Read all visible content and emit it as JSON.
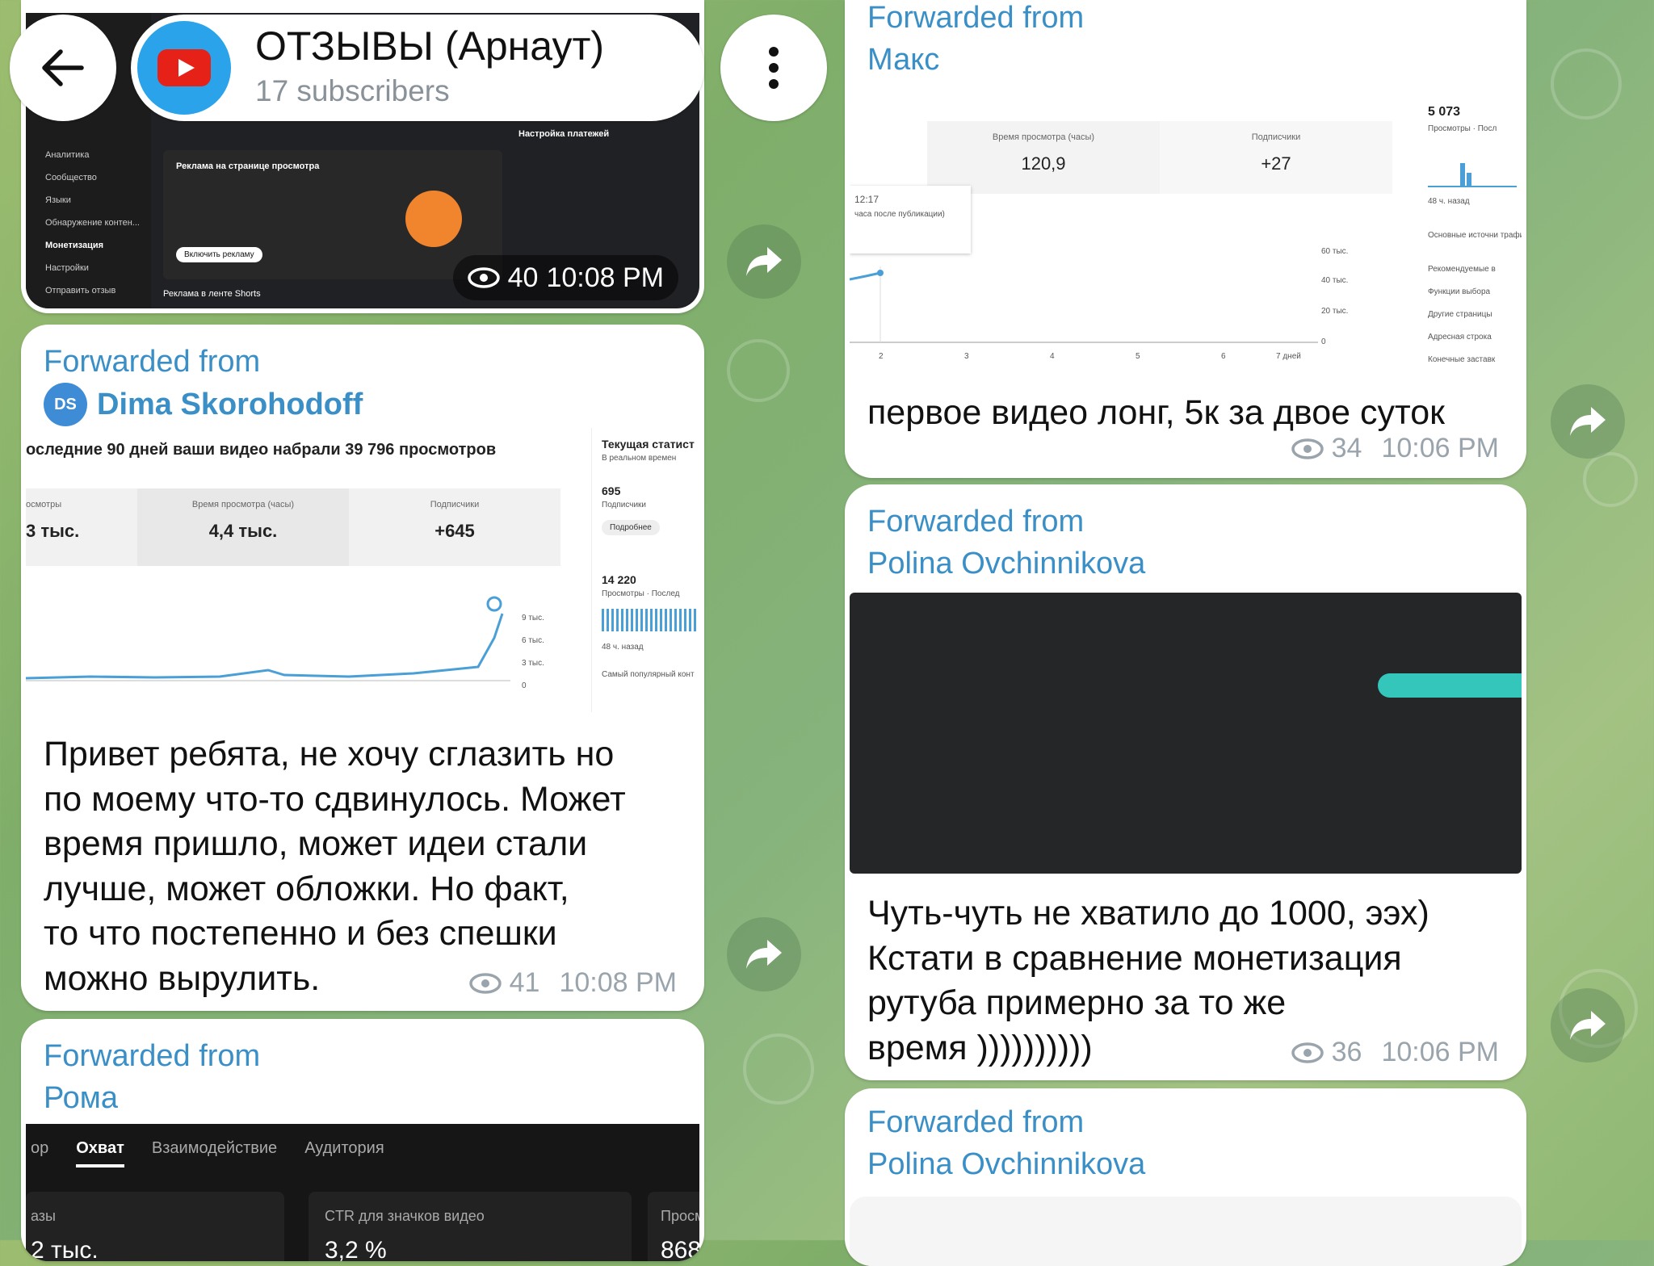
{
  "header": {
    "title": "ОТЗЫВЫ (Арнаут)",
    "subscribers": "17 subscribers"
  },
  "left": {
    "post1": {
      "views": "40",
      "time": "10:08 PM",
      "shot_menu": [
        "Аналитика",
        "Сообщество",
        "Языки",
        "Обнаружение контен...",
        "Монетизация",
        "Настройки",
        "Отправить отзыв"
      ],
      "shot_heading": "Реклама на странице просмотра",
      "shot_button": "Включить рекламу",
      "shot_side_title": "Настройка платежей",
      "shot_bottom": "Реклама в ленте Shorts"
    },
    "post2": {
      "fwd_label": "Forwarded from",
      "fwd_initials": "DS",
      "fwd_name": "Dima Skorohodoff",
      "shot_heading": "оследние 90 дней ваши видео набрали 39 796 просмотров",
      "stat1_label": "осмотры",
      "stat1_value": "3 тыс.",
      "stat2_label": "Время просмотра (часы)",
      "stat2_value": "4,4 тыс.",
      "stat3_label": "Подписчики",
      "stat3_value": "+645",
      "side_title": "Текущая статист",
      "side_sub": "В реальном времен",
      "side_v1": "695",
      "side_v1_label": "Подписчики",
      "side_button": "Подробнее",
      "side_v2": "14 220",
      "side_v2_label": "Просмотры · Послед",
      "side_ago": "48 ч. назад",
      "side_popular": "Самый популярный конт",
      "y_ticks": [
        "9 тыс.",
        "6 тыс.",
        "3 тыс.",
        "0"
      ],
      "text": "Привет ребята, не хочу сглазить но\nпо моему что-то сдвинулось. Может\nвремя пришло, может идеи стали\nлучше, может обложки. Но факт,\nто что постепенно и без спешки\nможно вырулить.",
      "views": "41",
      "time": "10:08 PM"
    },
    "post3": {
      "fwd_label": "Forwarded from",
      "fwd_name": "Рома",
      "tabs": [
        "ор",
        "Охват",
        "Взаимодействие",
        "Аудитория"
      ],
      "card1_label": "азы",
      "card1_value": "2 тыс.",
      "card2_label": "CTR для значков видео",
      "card2_value": "3,2 %",
      "card3_label": "Просм",
      "card3_value": "868"
    }
  },
  "right": {
    "post1": {
      "fwd_label": "Forwarded from",
      "fwd_name": "Макс",
      "stat1_label": "Время просмотра (часы)",
      "stat1_value": "120,9",
      "stat2_label": "Подписчики",
      "stat2_value": "+27",
      "side_value": "5 073",
      "side_label": "Просмотры · Посл",
      "side_ago": "48 ч. назад",
      "side_list": [
        "Основные источни трафика",
        "Рекомендуемые в",
        "Функции выбора",
        "Другие страницы",
        "Адресная строка",
        "Конечные заставк"
      ],
      "tooltip_time": "12:17",
      "tooltip_text": "часа после публикации)",
      "y_ticks": [
        "60 тыс.",
        "40 тыс.",
        "20 тыс.",
        "0"
      ],
      "x_ticks": [
        "2",
        "3",
        "4",
        "5",
        "6",
        "7 дней"
      ],
      "text": "первое видео лонг, 5к за двое суток",
      "views": "34",
      "time": "10:06 PM"
    },
    "post2": {
      "fwd_label": "Forwarded from",
      "fwd_name": "Polina Ovchinnikova",
      "text": "Чуть-чуть не хватило до 1000, ээх)\nКстати в сравнение монетизация\nрутуба примерно за то же\nвремя ))))))))))",
      "views": "36",
      "time": "10:06 PM"
    },
    "post3": {
      "fwd_label": "Forwarded from",
      "fwd_name": "Polina Ovchinnikova"
    }
  }
}
